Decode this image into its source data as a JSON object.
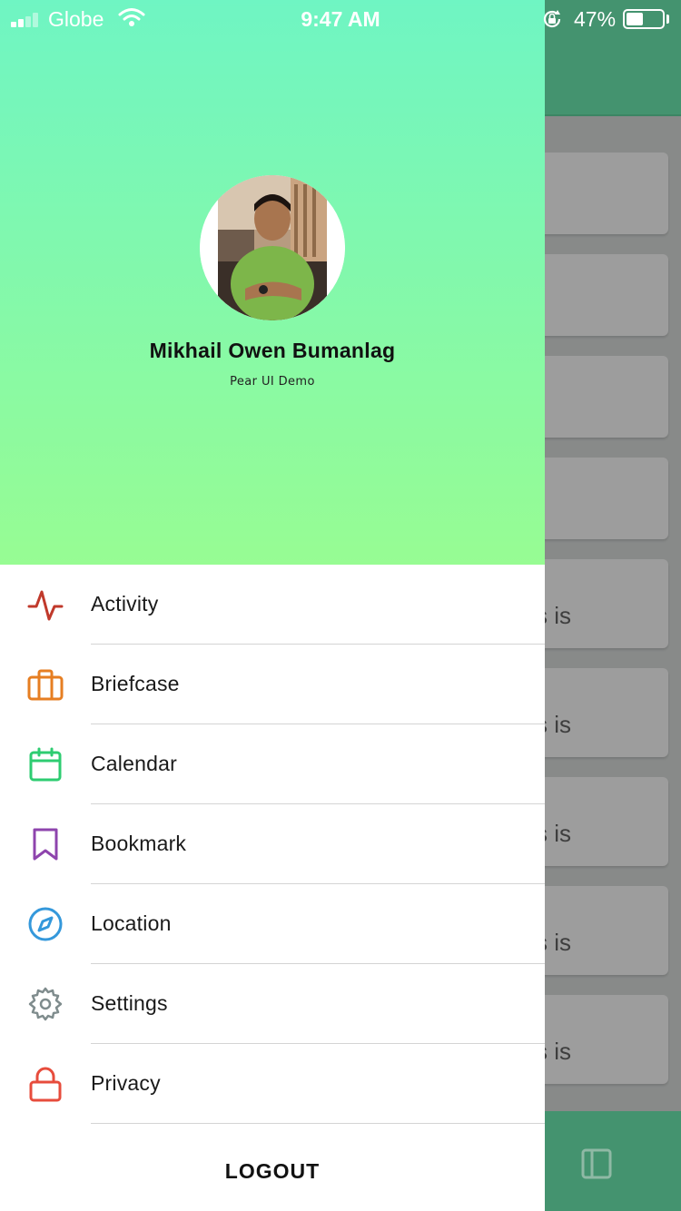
{
  "status_bar": {
    "carrier": "Globe",
    "time": "9:47 AM",
    "battery_percent": "47%",
    "battery_level": 0.47,
    "signal_bars": 2
  },
  "drawer": {
    "profile": {
      "name": "Mikhail Owen Bumanlag",
      "subtitle": "Pear UI Demo",
      "avatar_icon": "profile-photo"
    },
    "gradient": {
      "top": "#6ff5c3",
      "bottom": "#97fc93"
    },
    "menu": [
      {
        "label": "Activity",
        "icon": "activity-icon",
        "color": "#c0392b"
      },
      {
        "label": "Briefcase",
        "icon": "briefcase-icon",
        "color": "#e67e22"
      },
      {
        "label": "Calendar",
        "icon": "calendar-icon",
        "color": "#2ecc71"
      },
      {
        "label": "Bookmark",
        "icon": "bookmark-icon",
        "color": "#8e44ad"
      },
      {
        "label": "Location",
        "icon": "compass-icon",
        "color": "#3498db"
      },
      {
        "label": "Settings",
        "icon": "gear-icon",
        "color": "#7f8c8d"
      },
      {
        "label": "Privacy",
        "icon": "lock-icon",
        "color": "#e74c3c"
      }
    ],
    "logout_label": "LOGOUT"
  },
  "background": {
    "header_color": "#44936f",
    "card_snippets": [
      "s is",
      "s is",
      "s is",
      "s is",
      "s is"
    ],
    "tab_icon": "sidebar-icon"
  }
}
